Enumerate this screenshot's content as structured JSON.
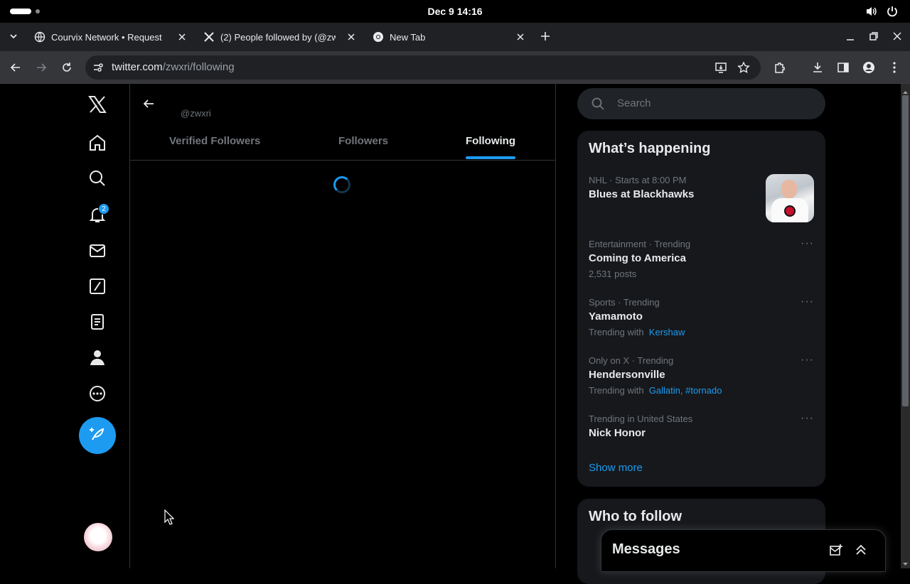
{
  "system": {
    "clock": "Dec 9  14:16",
    "volume_icon": "volume-icon",
    "power_icon": "power-icon"
  },
  "browser": {
    "tabs": [
      {
        "title": "Courvix Network • Request",
        "icon": "courvix-favicon"
      },
      {
        "title": "(2) People followed by (@zw",
        "icon": "x-favicon"
      },
      {
        "title": "New Tab",
        "icon": "chrome-favicon"
      }
    ],
    "url_domain": "twitter.com",
    "url_path": "/zwxri/following"
  },
  "nav": {
    "notifications_badge": "2"
  },
  "profile": {
    "handle": "@zwxri",
    "tabs": [
      "Verified Followers",
      "Followers",
      "Following"
    ],
    "active_tab": "Following"
  },
  "search": {
    "placeholder": "Search"
  },
  "whats_happening": {
    "title": "What’s happening",
    "trends": [
      {
        "meta": "NHL · Starts at 8:00 PM",
        "name": "Blues at Blackhawks"
      },
      {
        "meta": "Entertainment · Trending",
        "name": "Coming to America",
        "sub": "2,531 posts"
      },
      {
        "meta": "Sports · Trending",
        "name": "Yamamoto",
        "sub_prefix": "Trending with",
        "links": "Kershaw"
      },
      {
        "meta": "Only on X · Trending",
        "name": "Hendersonville",
        "sub_prefix": "Trending with",
        "links": "Gallatin, #tornado"
      },
      {
        "meta": "Trending in United States",
        "name": "Nick Honor"
      }
    ],
    "show_more": "Show more"
  },
  "who_to_follow": {
    "title": "Who to follow"
  },
  "messages": {
    "title": "Messages"
  },
  "colors": {
    "accent": "#1d9bf0",
    "background": "#000000",
    "panel": "#16181c",
    "muted": "#71767b"
  }
}
